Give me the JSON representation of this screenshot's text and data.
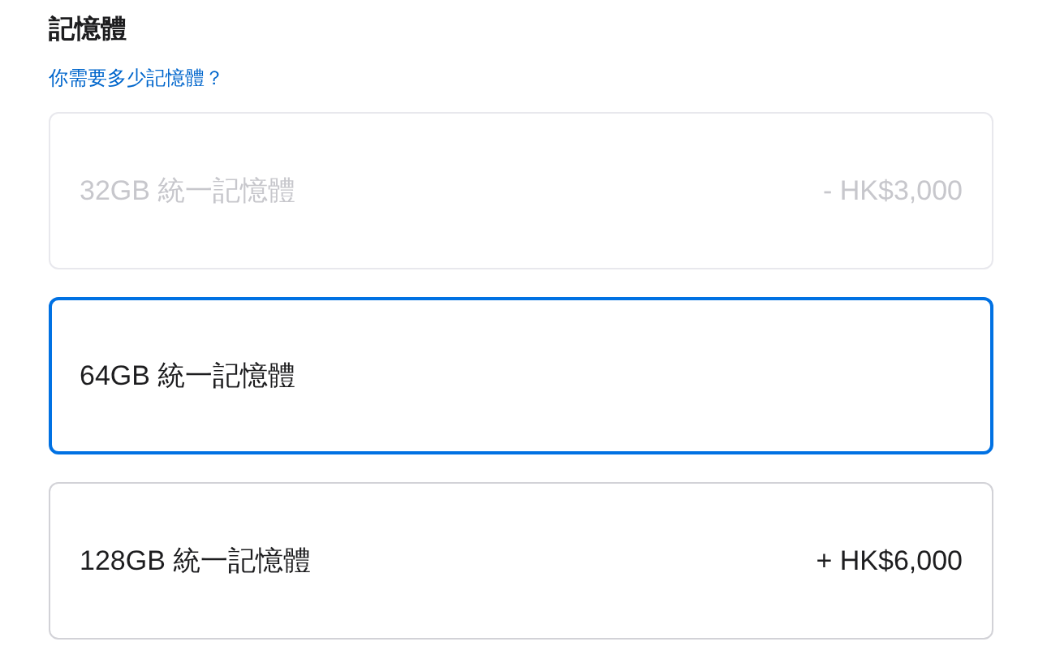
{
  "section": {
    "title": "記憶體",
    "help_link": "你需要多少記憶體？"
  },
  "options": [
    {
      "label": "32GB 統一記憶體",
      "price": "- HK$3,000",
      "disabled": true,
      "selected": false
    },
    {
      "label": "64GB 統一記憶體",
      "disabled": false,
      "selected": true
    },
    {
      "label": "128GB 統一記憶體",
      "price": "+ HK$6,000",
      "disabled": false,
      "selected": false
    }
  ]
}
